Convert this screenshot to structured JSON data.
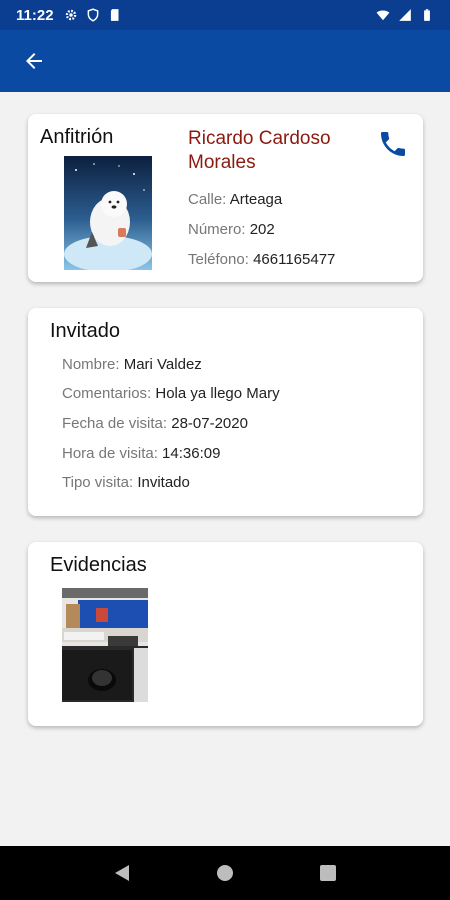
{
  "status_bar": {
    "time": "11:22",
    "left_icons": [
      "gear-icon",
      "shield-icon",
      "sd-card-icon"
    ],
    "right_icons": [
      "wifi-icon",
      "signal-icon",
      "battery-icon"
    ]
  },
  "app_bar": {
    "color": "#0b4aa2",
    "back_icon": "arrow-left-icon"
  },
  "host": {
    "title": "Anfitrión",
    "name": "Ricardo Cardoso Morales",
    "name_color": "#8b1a10",
    "fields": {
      "calle_label": "Calle:",
      "calle_value": "Arteaga",
      "numero_label": "Número:",
      "numero_value": "202",
      "telefono_label": "Teléfono:",
      "telefono_value": "4661165477"
    },
    "call_icon": "phone-icon"
  },
  "guest": {
    "title": "Invitado",
    "fields": {
      "nombre_label": "Nombre:",
      "nombre_value": "Mari Valdez",
      "comentarios_label": "Comentarios:",
      "comentarios_value": "Hola ya llego Mary",
      "fecha_label": "Fecha de visita:",
      "fecha_value": "28-07-2020",
      "hora_label": "Hora de visita:",
      "hora_value": "14:36:09",
      "tipo_label": "Tipo visita:",
      "tipo_value": "Invitado"
    }
  },
  "evidence": {
    "title": "Evidencias"
  },
  "nav_bar": {
    "icons": [
      "back-triangle-icon",
      "home-circle-icon",
      "recents-square-icon"
    ]
  }
}
